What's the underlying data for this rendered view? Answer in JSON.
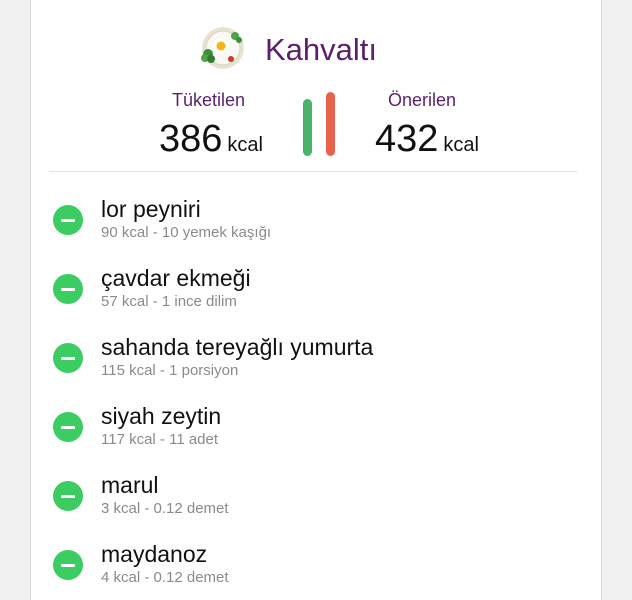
{
  "meal": {
    "title": "Kahvaltı",
    "icon": "breakfast-plate-icon"
  },
  "summary": {
    "consumed_label": "Tüketilen",
    "consumed_value": "386",
    "consumed_unit": "kcal",
    "recommended_label": "Önerilen",
    "recommended_value": "432",
    "recommended_unit": "kcal",
    "consumed_ratio": 0.89,
    "recommended_ratio": 1.0
  },
  "colors": {
    "title": "#5a1f6d",
    "consumed_bar": "#49b36c",
    "recommended_bar": "#e9624b",
    "remove_button": "#3bcc62"
  },
  "items": [
    {
      "name": "lor peyniri",
      "detail": "90 kcal - 10 yemek kaşığı"
    },
    {
      "name": "çavdar ekmeği",
      "detail": "57 kcal - 1 ince dilim"
    },
    {
      "name": "sahanda tereyağlı yumurta",
      "detail": "115 kcal - 1 porsiyon"
    },
    {
      "name": "siyah zeytin",
      "detail": "117 kcal - 11 adet"
    },
    {
      "name": "marul",
      "detail": "3 kcal - 0.12 demet"
    },
    {
      "name": "maydanoz",
      "detail": "4 kcal - 0.12 demet"
    }
  ]
}
